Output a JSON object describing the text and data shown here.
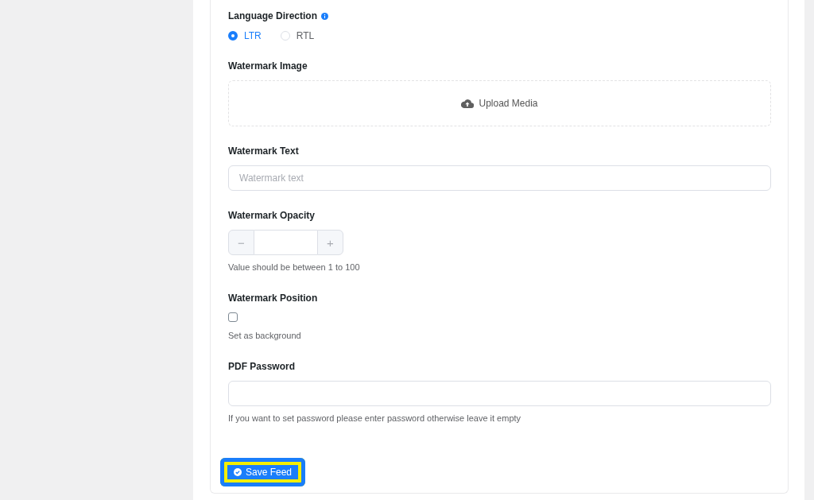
{
  "fields": [
    {
      "kind": "radio",
      "label": "Language Direction",
      "info": true,
      "options": [
        {
          "label": "LTR",
          "selected": true
        },
        {
          "label": "RTL",
          "selected": false
        }
      ]
    },
    {
      "kind": "upload",
      "label": "Watermark Image",
      "button": "Upload Media"
    },
    {
      "kind": "text",
      "label": "Watermark Text",
      "placeholder": "Watermark text"
    },
    {
      "kind": "number",
      "label": "Watermark Opacity",
      "decrement": "−",
      "increment": "+",
      "help": "Value should be between 1 to 100"
    },
    {
      "kind": "checkbox",
      "label": "Watermark Position",
      "checked": false,
      "caption": "Set as background"
    },
    {
      "kind": "password",
      "label": "PDF Password",
      "help": "If you want to set password please enter password otherwise leave it empty"
    }
  ],
  "save_button": {
    "label": "Save Feed",
    "highlighted": true
  }
}
